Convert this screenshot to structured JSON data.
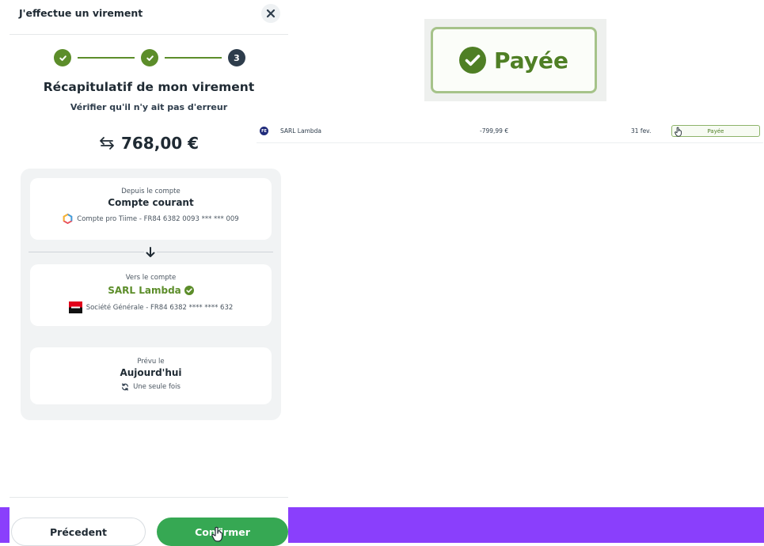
{
  "modal": {
    "title": "J'effectue un virement",
    "close_icon": "close-icon",
    "stepper": {
      "current_step": "3",
      "total_steps": 3,
      "completed_icon": "check-icon"
    },
    "heading": "Récapitulatif de mon virement",
    "subheading": "Vérifier qu'il n'y ait pas d'erreur",
    "amount": "768,00 €",
    "amount_icon": "transfer-arrows-icon",
    "from": {
      "label": "Depuis le compte",
      "account_name": "Compte courant",
      "bank_icon": "tiime-logo-icon",
      "detail": "Compte pro Tiime - FR84 6382 0093 *** *** 009"
    },
    "direction_icon": "arrow-down-icon",
    "to": {
      "label": "Vers le compte",
      "account_name": "SARL Lambda",
      "verified_icon": "verified-check-icon",
      "bank_icon": "societe-generale-logo-icon",
      "detail": "Société Générale - FR84 6382 **** **** 632"
    },
    "schedule": {
      "label": "Prévu le",
      "date": "Aujourd'hui",
      "recurrence_icon": "repeat-icon",
      "recurrence": "Une seule fois"
    },
    "buttons": {
      "previous": "Précedent",
      "confirm": "Confirmer"
    }
  },
  "zoom_badge": {
    "icon": "check-circle-icon",
    "label": "Payée"
  },
  "transaction": {
    "logo_text": "FE",
    "name": "SARL Lambda",
    "amount": "-799,99 €",
    "date": "31 fev.",
    "status": "Payée"
  },
  "colors": {
    "accent_green": "#5c8d2a",
    "confirm_green": "#36a853",
    "purple_band": "#8a3ffc",
    "dark": "#2e3d4c"
  }
}
